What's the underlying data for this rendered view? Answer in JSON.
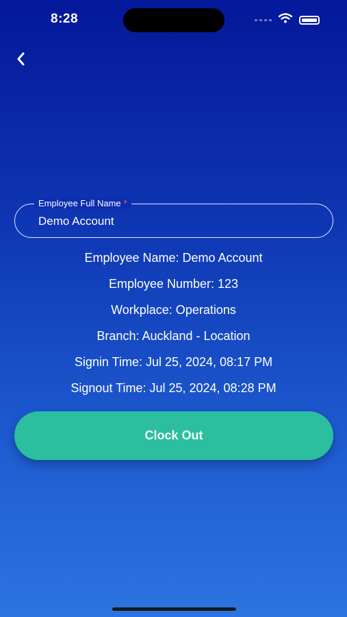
{
  "status_bar": {
    "time": "8:28",
    "icons": [
      "signal-icon",
      "wifi-icon",
      "battery-icon"
    ]
  },
  "nav": {
    "back_icon": "chevron-left-icon"
  },
  "form": {
    "employee_full_name": {
      "label": "Employee Full Name",
      "required_marker": "*",
      "value": "Demo Account"
    }
  },
  "info": {
    "employee_name": "Employee Name: Demo Account",
    "employee_number": "Employee Number: 123",
    "workplace": "Workplace: Operations",
    "branch": "Branch: Auckland - Location",
    "signin_time": "Signin Time: Jul 25, 2024, 08:17 PM",
    "signout_time": "Signout Time: Jul 25, 2024, 08:28 PM"
  },
  "actions": {
    "clock_out_label": "Clock Out"
  },
  "colors": {
    "accent": "#2bbfa0",
    "gradient_top": "#04189a",
    "gradient_bottom": "#2c74e0",
    "required": "#ff5a5a"
  }
}
